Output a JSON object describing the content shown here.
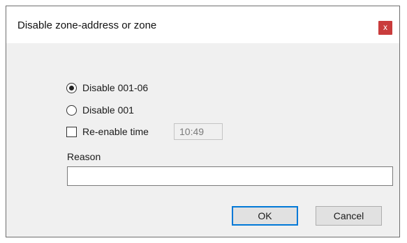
{
  "dialog": {
    "title": "Disable zone-address or zone",
    "close_label": "x"
  },
  "options": {
    "disable_zone_address": {
      "label": "Disable 001-06",
      "checked": true
    },
    "disable_zone": {
      "label": "Disable 001",
      "checked": false
    },
    "reenable_time": {
      "label": "Re-enable time",
      "checked": false,
      "value": "10:49"
    }
  },
  "reason": {
    "label": "Reason",
    "value": ""
  },
  "buttons": {
    "ok_label": "OK",
    "cancel_label": "Cancel"
  }
}
